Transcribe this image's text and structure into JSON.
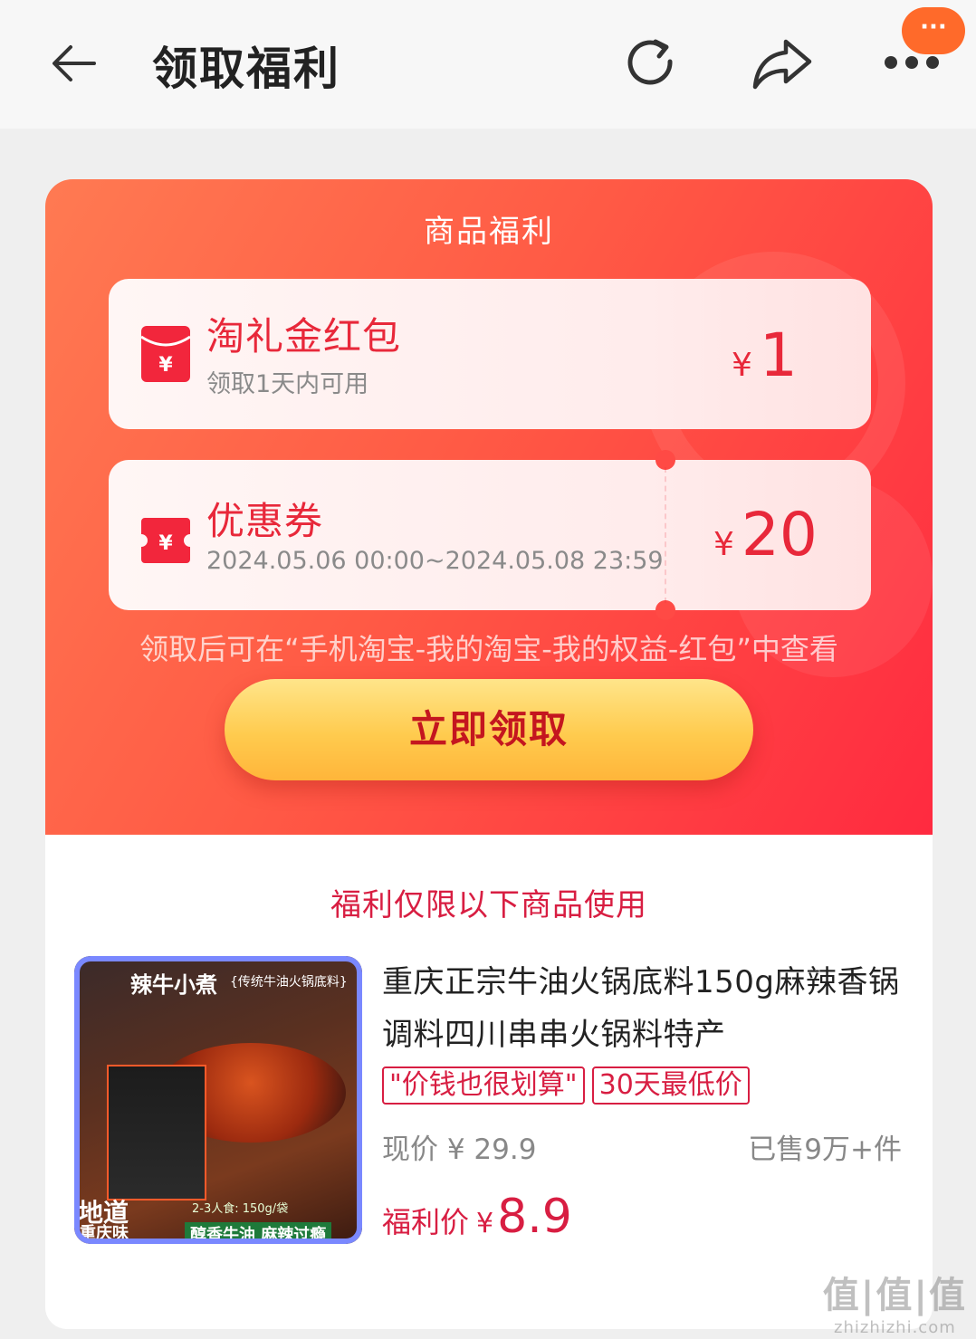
{
  "topbar": {
    "title": "领取福利",
    "more_badge": "···"
  },
  "panel": {
    "title": "商品福利",
    "cards": [
      {
        "name": "淘礼金红包",
        "sub": "领取1天内可用",
        "currency": "¥",
        "amount": "1",
        "icon": "red-envelope-icon"
      },
      {
        "name": "优惠券",
        "sub": "2024.05.06 00:00~2024.05.08 23:59",
        "currency": "¥",
        "amount": "20",
        "icon": "coupon-ticket-icon"
      }
    ],
    "hint": "领取后可在“手机淘宝-我的淘宝-我的权益-红包”中查看",
    "claim_button": "立即领取"
  },
  "product_section": {
    "note": "福利仅限以下商品使用",
    "product": {
      "title": "重庆正宗牛油火锅底料150g麻辣香锅调料四川串串火锅料特产",
      "tags": [
        "\"价钱也很划算\"",
        "30天最低价"
      ],
      "current_price": "现价 ¥ 29.9",
      "sold": "已售9万+件",
      "welfare_label": "福利价",
      "welfare_currency": "¥",
      "welfare_price": "8.9",
      "image_text": {
        "name": "辣牛小煮",
        "subtitle": "{传统牛油火锅底料}",
        "badge_big": "地道",
        "badge_small": "重庆味",
        "slogan": "醇香牛油 麻辣过瘾",
        "serving": "2-3人食: 150g/袋"
      }
    }
  },
  "watermark": {
    "main": "值|值|值",
    "sub": "zhizhizhi.com"
  },
  "colors": {
    "accent_red": "#e8283a",
    "panel_gradient_start": "#ff7a52",
    "panel_gradient_end": "#ff2a40",
    "button_yellow": "#ffcb4e"
  }
}
